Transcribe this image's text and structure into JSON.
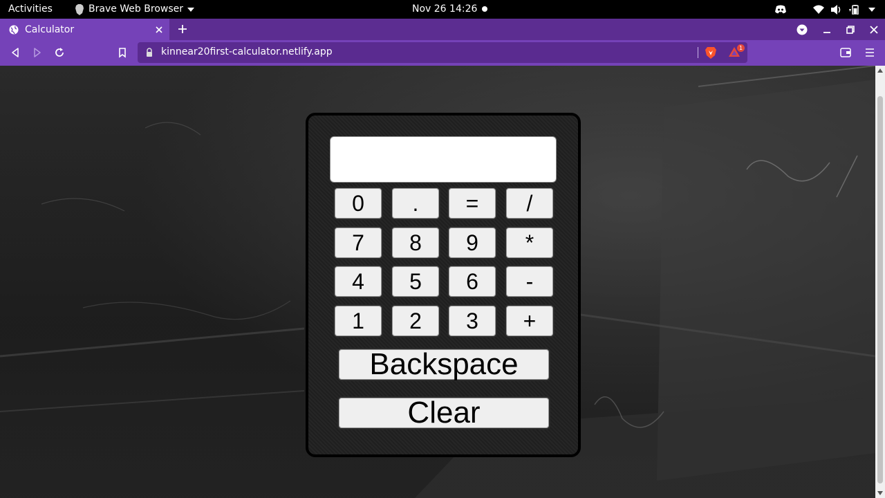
{
  "system_bar": {
    "activities": "Activities",
    "app_name": "Brave Web Browser",
    "clock": "Nov 26  14:26"
  },
  "browser": {
    "tab_title": "Calculator",
    "url": "kinnear20first-calculator.netlify.app",
    "rewards_badge": "1",
    "accent_color": "#7542b8"
  },
  "calculator": {
    "display_value": "",
    "keys": [
      [
        "0",
        ".",
        "=",
        "/"
      ],
      [
        "7",
        "8",
        "9",
        "*"
      ],
      [
        "4",
        "5",
        "6",
        "-"
      ],
      [
        "1",
        "2",
        "3",
        "+"
      ]
    ],
    "backspace_label": "Backspace",
    "clear_label": "Clear"
  }
}
